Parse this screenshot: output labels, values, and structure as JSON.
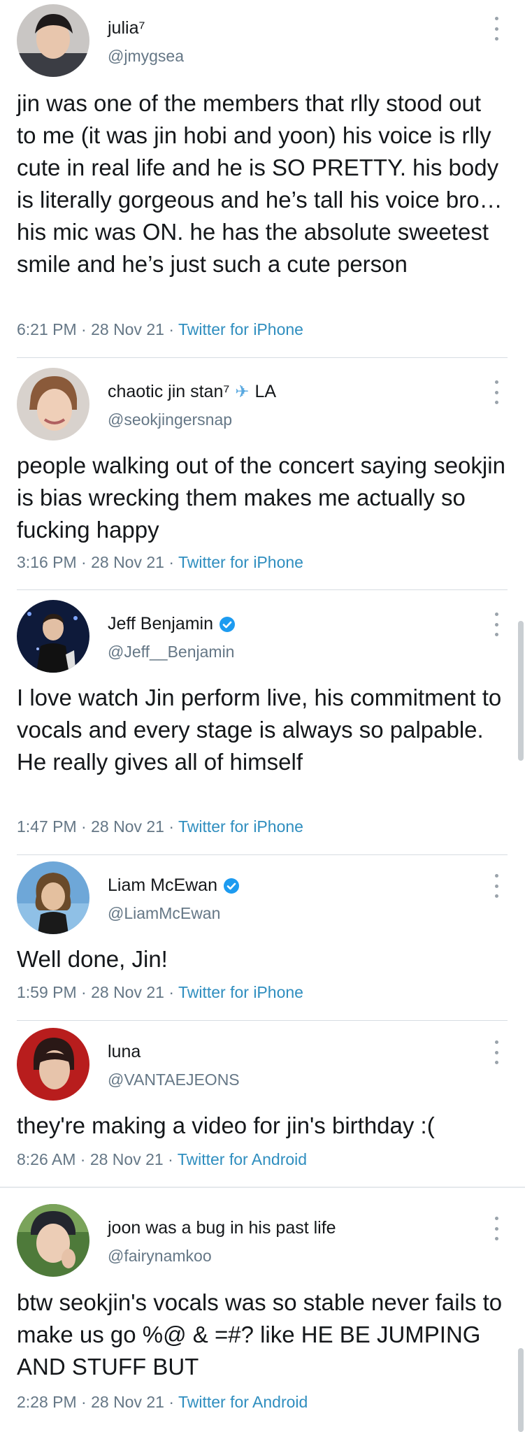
{
  "tweets": [
    {
      "name": "julia⁷",
      "handle": "@jmygsea",
      "verified": false,
      "text": "jin was one of the members that rlly stood out to me (it was jin hobi and yoon) his voice is rlly cute in real life and he is SO PRETTY. his body is literally gorgeous and he’s tall his voice bro…his mic was ON. he has the absolute sweetest smile and he’s just such a cute person",
      "time": "6:21 PM · 28 Nov 21 · ",
      "source": "Twitter for iPhone"
    },
    {
      "name": "chaotic jin stan⁷",
      "name_suffix": "LA",
      "handle": "@seokjingersnap",
      "verified": false,
      "text": "people walking out of the concert saying seokjin is bias wrecking them makes me actually so fucking happy",
      "time": "3:16 PM · 28 Nov 21 · ",
      "source": "Twitter for iPhone"
    },
    {
      "name": "Jeff Benjamin",
      "handle": "@Jeff__Benjamin",
      "verified": true,
      "text": "I love watch Jin perform live, his commitment to vocals and every stage is always so palpable. He really gives all of himself",
      "time": "1:47 PM · 28 Nov 21 · ",
      "source": "Twitter for iPhone"
    },
    {
      "name": "Liam McEwan",
      "handle": "@LiamMcEwan",
      "verified": true,
      "text": "Well done, Jin!",
      "time": "1:59 PM · 28 Nov 21 · ",
      "source": "Twitter for iPhone"
    },
    {
      "name": "luna",
      "handle": "@VANTAEJEONS",
      "verified": false,
      "text": "they're making a video for jin's birthday :(",
      "time": "8:26 AM · 28 Nov 21 · ",
      "source": "Twitter for Android"
    },
    {
      "name": "joon was a bug in his past life",
      "handle": "@fairynamkoo",
      "verified": false,
      "text": "btw seokjin's vocals was so stable never fails to make us go %@ & =#? like HE BE JUMPING AND STUFF BUT",
      "time": "2:28 PM · 28 Nov 21 · ",
      "source": "Twitter for Android"
    }
  ],
  "icons": {
    "verified": "verified-badge-icon",
    "more": "more-vertical-icon",
    "airplane": "airplane-icon"
  },
  "colors": {
    "link": "#2f8ebf",
    "verified": "#1d9bf0",
    "muted": "#657786"
  }
}
